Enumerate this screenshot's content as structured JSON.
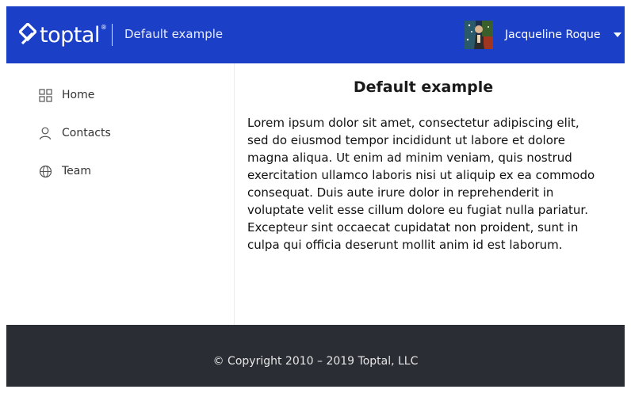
{
  "header": {
    "logo_text": "toptal",
    "logo_reg": "®",
    "app_title": "Default example",
    "user_name": "Jacqueline Roque"
  },
  "sidebar": {
    "items": [
      {
        "label": "Home",
        "icon": "grid-icon"
      },
      {
        "label": "Contacts",
        "icon": "user-icon"
      },
      {
        "label": "Team",
        "icon": "globe-icon"
      }
    ]
  },
  "main": {
    "title": "Default example",
    "body": "Lorem ipsum dolor sit amet, consectetur adipiscing elit, sed do eiusmod tempor incididunt ut labore et dolore magna aliqua. Ut enim ad minim veniam, quis nostrud exercitation ullamco laboris nisi ut aliquip ex ea commodo consequat. Duis aute irure dolor in reprehenderit in voluptate velit esse cillum dolore eu fugiat nulla pariatur. Excepteur sint occaecat cupidatat non proident, sunt in culpa qui officia deserunt mollit anim id est laborum."
  },
  "footer": {
    "copyright": "© Copyright 2010 – 2019 Toptal, LLC"
  },
  "colors": {
    "header_bg": "#1b3fc6",
    "footer_bg": "#2b2d34"
  }
}
